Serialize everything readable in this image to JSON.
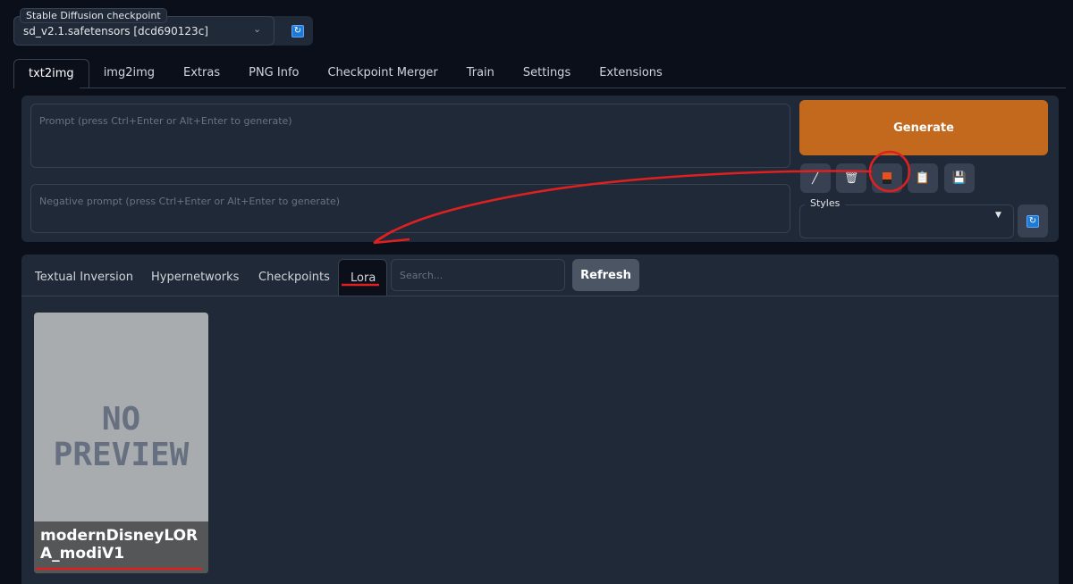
{
  "checkpoint": {
    "label": "Stable Diffusion checkpoint",
    "value": "sd_v2.1.safetensors [dcd690123c]"
  },
  "tabs": [
    "txt2img",
    "img2img",
    "Extras",
    "PNG Info",
    "Checkpoint Merger",
    "Train",
    "Settings",
    "Extensions"
  ],
  "prompt": {
    "placeholder": "Prompt (press Ctrl+Enter or Alt+Enter to generate)"
  },
  "negative_prompt": {
    "placeholder": "Negative prompt (press Ctrl+Enter or Alt+Enter to generate)"
  },
  "generate_label": "Generate",
  "styles_label": "Styles",
  "extra_tabs": [
    "Textual Inversion",
    "Hypernetworks",
    "Checkpoints",
    "Lora"
  ],
  "search_placeholder": "Search...",
  "refresh_label": "Refresh",
  "card": {
    "preview_text_1": "NO",
    "preview_text_2": "PREVIEW",
    "name": "modernDisneyLORA_modiV1"
  },
  "colors": {
    "accent": "#c2691d",
    "annotation": "#e02020"
  }
}
